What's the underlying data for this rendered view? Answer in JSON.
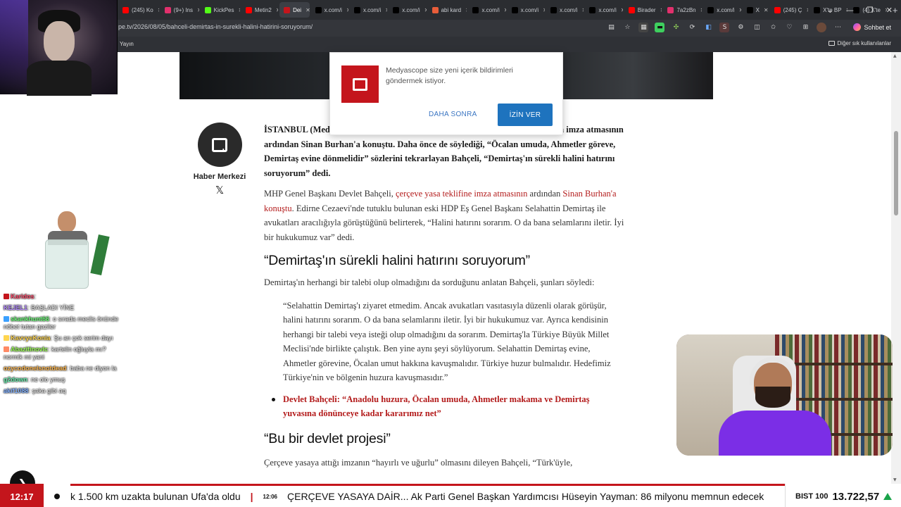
{
  "browser": {
    "tabs": [
      {
        "label": "(245) Ko",
        "color": "#ff0000"
      },
      {
        "label": "(9+) Ins",
        "color": "#e1306c"
      },
      {
        "label": "KickPes",
        "color": "#53fc18"
      },
      {
        "label": "Metin2",
        "color": "#ff0000"
      },
      {
        "label": "Dei",
        "color": "#c4151c",
        "active": true
      },
      {
        "label": "x.com/i",
        "color": "#000000"
      },
      {
        "label": "x.com/i",
        "color": "#000000"
      },
      {
        "label": "x.com/i",
        "color": "#000000"
      },
      {
        "label": "abi kard",
        "color": "#e85d3a"
      },
      {
        "label": "x.com/i",
        "color": "#000000"
      },
      {
        "label": "x.com/i",
        "color": "#000000"
      },
      {
        "label": "x.com/i",
        "color": "#000000"
      },
      {
        "label": "x.com/i",
        "color": "#000000"
      },
      {
        "label": "Birader",
        "color": "#ff0000"
      },
      {
        "label": "7a2zBn",
        "color": "#e1306c"
      },
      {
        "label": "x.com/i",
        "color": "#000000"
      },
      {
        "label": "X",
        "color": "#000000"
      },
      {
        "label": "(245) Ç",
        "color": "#ff0000"
      },
      {
        "label": "X'te BP",
        "color": "#000000"
      },
      {
        "label": "(4) X'te",
        "color": "#000000"
      }
    ],
    "new_tab": "+",
    "url": "pe.tv/2026/08/05/bahceli-demirtas-in-surekli-halini-hatirini-soruyorum/",
    "chat_button": "Sohbet et",
    "bookmark_left": "Yayın",
    "bookmark_right": "Diğer sık kullanılanlar"
  },
  "notification": {
    "message": "Medyascope size yeni içerik bildirimleri göndermek istiyor.",
    "later": "DAHA SONRA",
    "allow": "İZİN VER"
  },
  "author": {
    "name": "Haber Merkezi",
    "social": "𝕏"
  },
  "article": {
    "lead": "İSTANBUL (Medyascope) – MHP Genel Başkanı Devlet Bahçeli, çerçeve yasaya imza atmasının ardından Sinan Burhan'a konuştu. Daha önce de söylediği, “Öcalan umuda, Ahmetler göreve, Demirtaş evine dönmelidir” sözlerini tekrarlayan Bahçeli, “Demirtaş'ın sürekli halini hatırını soruyorum” dedi.",
    "p1_a": "MHP Genel Başkanı Devlet Bahçeli, ",
    "p1_link1": "çerçeve yasa teklifine imza atmasının",
    "p1_b": " ardından ",
    "p1_link2": "Sinan Burhan'a konuştu",
    "p1_c": ". Edirne Cezaevi'nde tutuklu bulunan eski HDP Eş Genel Başkanı Selahattin Demirtaş ile avukatları aracılığıyla görüştüğünü belirterek, “Halini hatırını sorarım. O da bana selamlarını iletir. İyi bir hukukumuz var” dedi.",
    "h2_1": "“Demirtaş'ın sürekli halini hatırını soruyorum”",
    "p2": "Demirtaş'ın herhangi bir talebi olup olmadığını da sorduğunu anlatan Bahçeli, şunları söyledi:",
    "quote": "“Selahattin Demirtaş'ı ziyaret etmedim. Ancak avukatları vasıtasıyla düzenli olarak görüşür, halini hatırını sorarım. O da bana selamlarını iletir. İyi bir hukukumuz var. Ayrıca kendisinin herhangi bir talebi veya isteği olup olmadığını da sorarım. Demirtaş'la Türkiye Büyük Millet Meclisi'nde birlikte çalıştık. Ben yine aynı şeyi söylüyorum. Selahattin Demirtaş evine, Ahmetler görevine, Öcalan umut hakkına kavuşmalıdır. Türkiye huzur bulmalıdır. Hedefimiz Türkiye'nin ve bölgenin huzura kavuşmasıdır.”",
    "bullet": "Devlet Bahçeli: “Anadolu huzura, Öcalan umuda, Ahmetler makama ve Demirtaş yuvasına dönünceye kadar kararımız net”",
    "h2_2": "“Bu bir devlet projesi”",
    "p3": "Çerçeve yasaya attığı imzanın “hayırlı ve uğurlu” olmasını dileyen Bahçeli, “Türk'üyle,"
  },
  "chat": [
    {
      "user": "Karidos",
      "text": "",
      "color": "#ff4d6d",
      "badge": "#c4151c"
    },
    {
      "user": "KEJEL1",
      "text": "BAŞLADI YİNE",
      "color": "#b388ff",
      "badge": ""
    },
    {
      "user": "skankhunt66",
      "text": "o sırada meclis önünde nöbet tutan gaziler",
      "color": "#6dff7a",
      "badge": "#3aa0ff"
    },
    {
      "user": "KavvyeKonia",
      "text": "Şu an çok serim dayı",
      "color": "#ffd54f",
      "badge": "#ffd54f"
    },
    {
      "user": "AbazitinovIc",
      "text": "kartelin oğluyla mı? normik mi yani",
      "color": "#9cff57",
      "badge": "#ff8a65"
    },
    {
      "user": "ozycodonelsnotdead",
      "text": "baba ne diyon la",
      "color": "#ffb74d",
      "badge": ""
    },
    {
      "user": "g2down",
      "text": "ne olo ymuş",
      "color": "#69f0ae",
      "badge": ""
    },
    {
      "user": "akif1088",
      "text": "şaka gibi aq",
      "color": "#82b1ff",
      "badge": ""
    }
  ],
  "ticker": {
    "time": "12:17",
    "item1": "k 1.500 km uzakta bulunan Ufa'da oldu",
    "separator": "|",
    "small_time": "12:06",
    "item2": "ÇERÇEVE YASAYA DAİR... Ak Parti Genel Başkan Yardımcısı Hüseyin Yayman: 86 milyonu memnun edecek",
    "market_label": "BIST 100",
    "market_value": "13.722,57",
    "market_trend": "up"
  },
  "colors": {
    "brand": "#c4151c",
    "link": "#b31b1b",
    "allow_button": "#1e73be",
    "market_up": "#1aa34a"
  }
}
